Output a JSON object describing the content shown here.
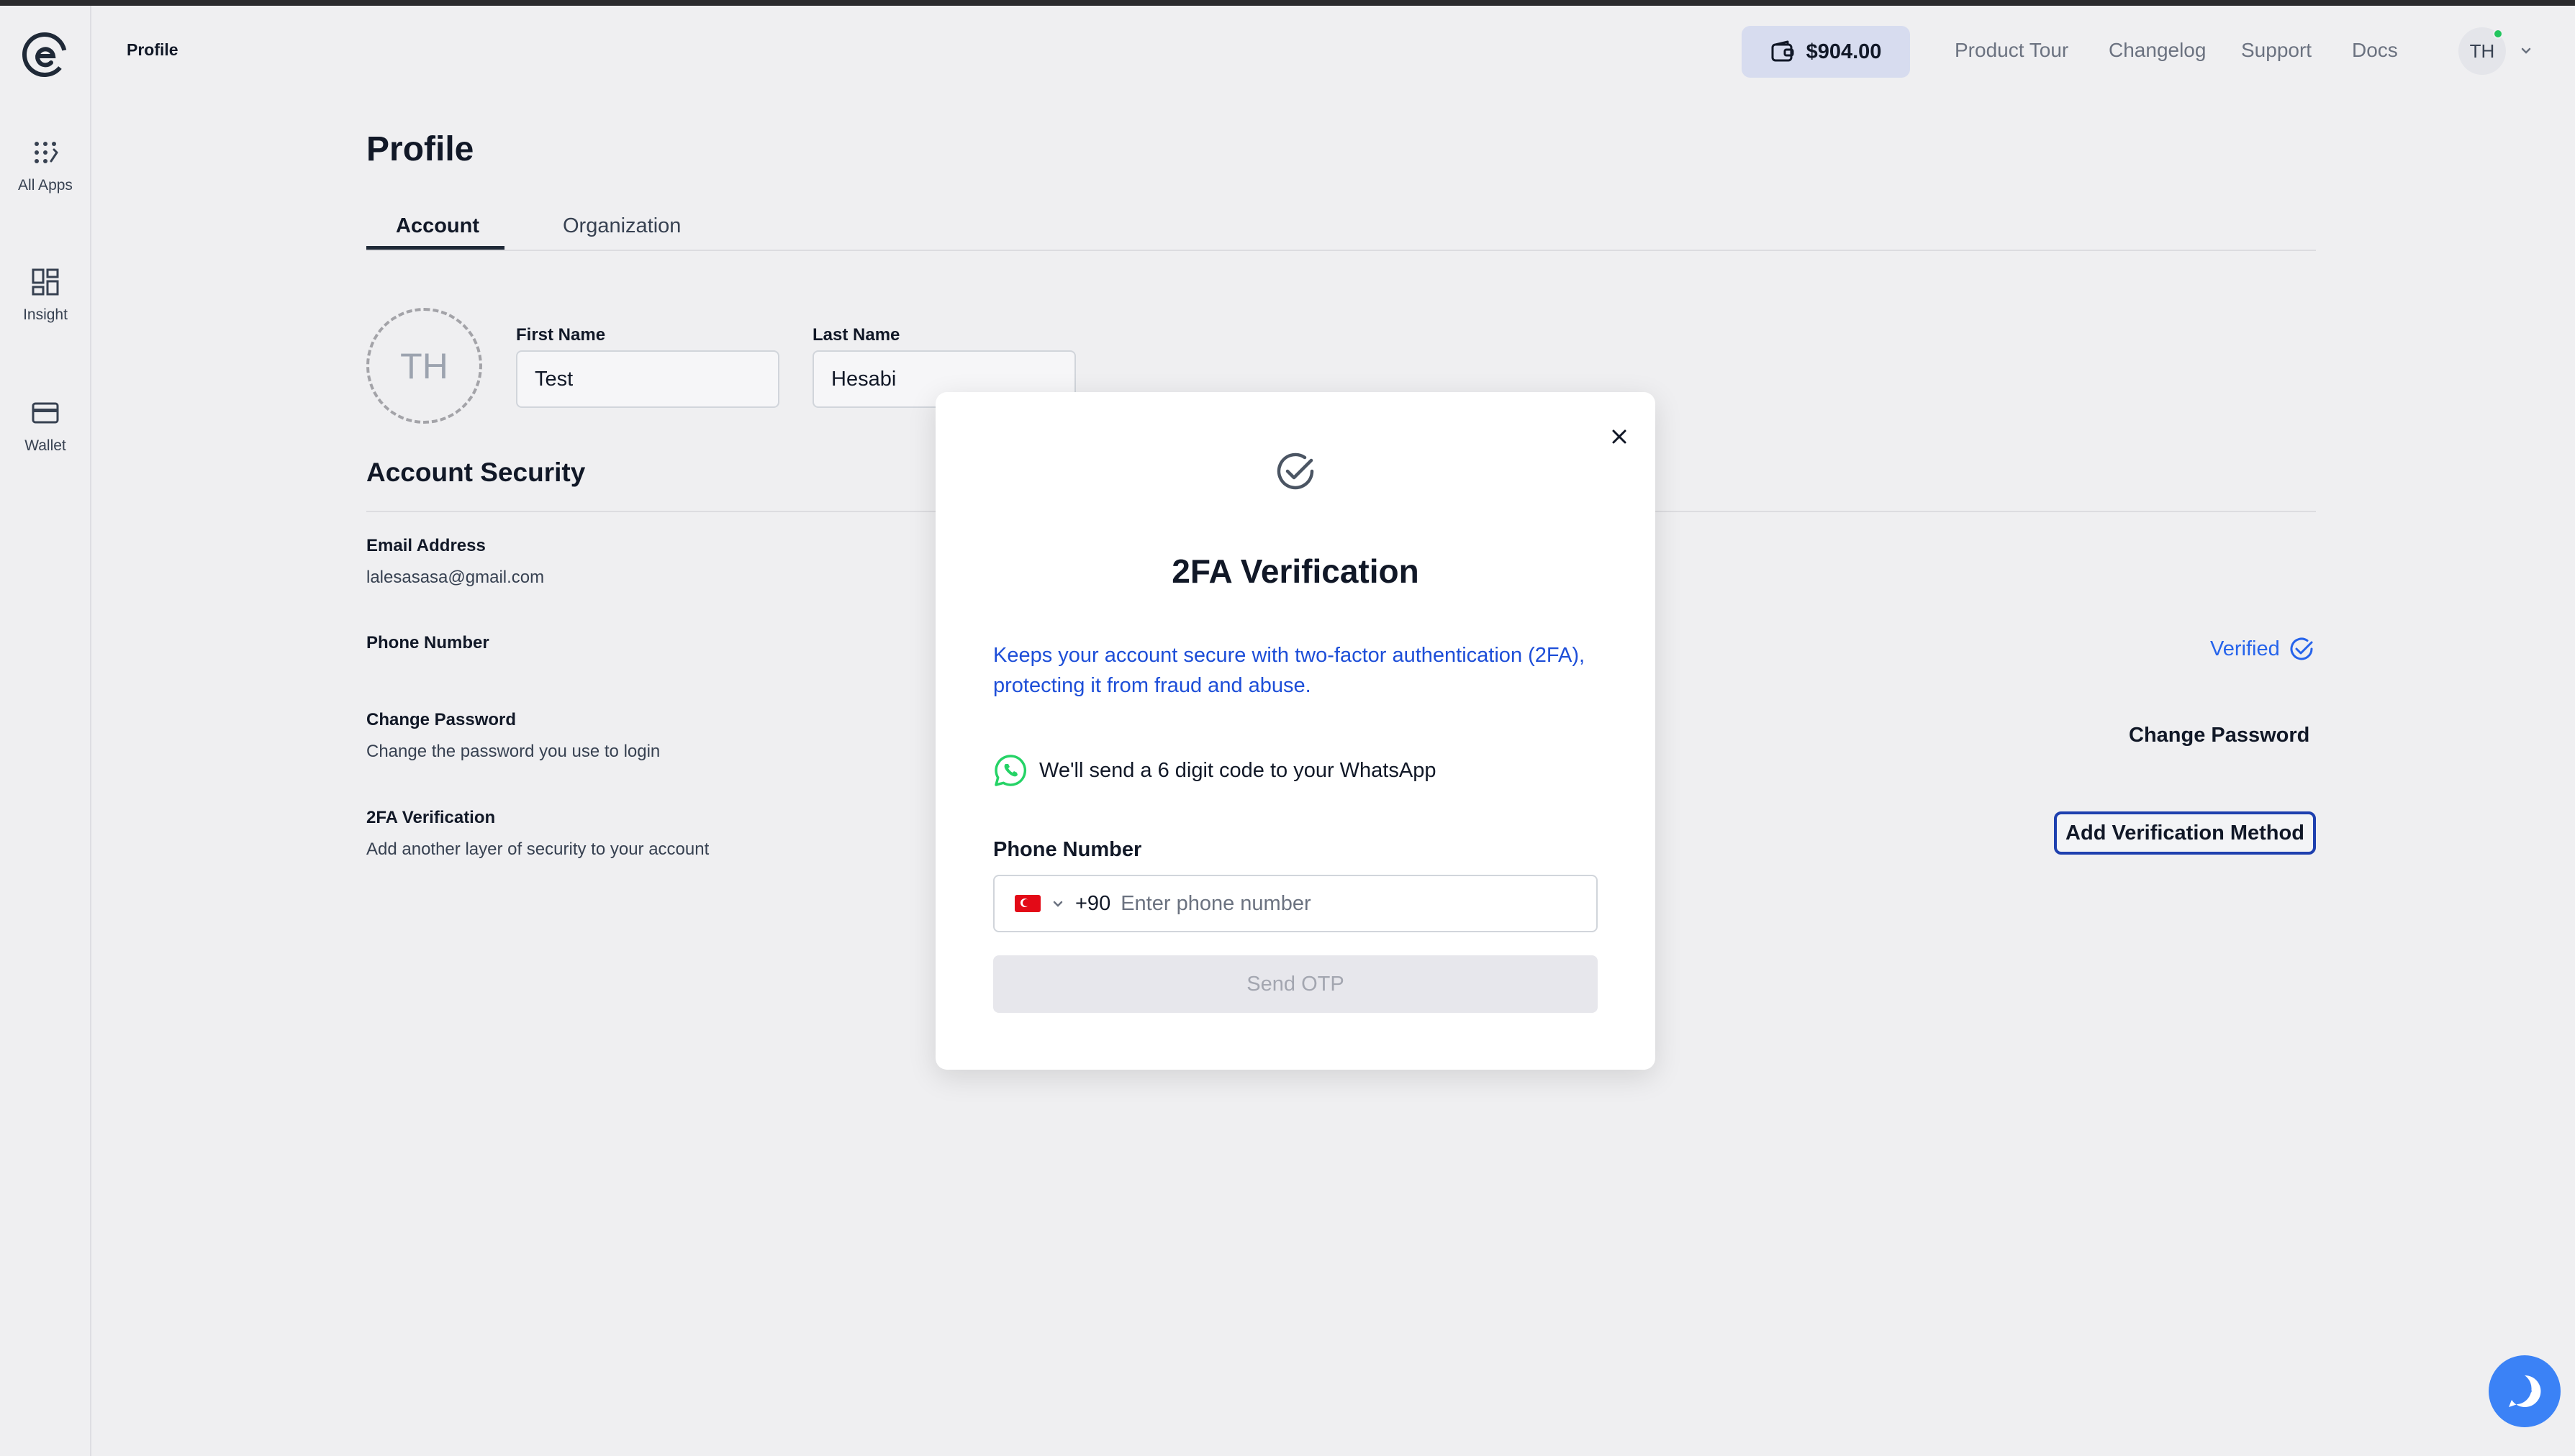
{
  "header": {
    "breadcrumb": "Profile",
    "wallet_balance": "$904.00",
    "nav": [
      "Product Tour",
      "Changelog",
      "Support",
      "Docs"
    ],
    "user_initials": "TH"
  },
  "sidebar": {
    "items": [
      {
        "label": "All Apps",
        "icon": "apps-grid-icon"
      },
      {
        "label": "Insight",
        "icon": "dashboard-icon"
      },
      {
        "label": "Wallet",
        "icon": "card-icon"
      }
    ]
  },
  "page": {
    "title": "Profile",
    "tabs": [
      "Account",
      "Organization"
    ],
    "active_tab": "Account",
    "avatar_initials": "TH",
    "first_name_label": "First Name",
    "first_name_value": "Test",
    "last_name_label": "Last Name",
    "last_name_value": "Hesabi"
  },
  "security": {
    "title": "Account Security",
    "email_label": "Email Address",
    "email_value": "lalesasasa@gmail.com",
    "phone_label": "Phone Number",
    "verified_text": "Verified",
    "change_password_label": "Change Password",
    "change_password_sub": "Change the password you use to login",
    "change_password_button": "Change Password",
    "twofa_label": "2FA Verification",
    "twofa_sub": "Add another layer of security to your account",
    "add_verification_button": "Add Verification Method"
  },
  "modal": {
    "title": "2FA Verification",
    "description": "Keeps your account secure with two-factor authentication (2FA), protecting it from fraud and abuse.",
    "whatsapp_note": "We'll send a 6 digit code to your WhatsApp",
    "phone_label": "Phone Number",
    "dial_code": "+90",
    "phone_placeholder": "Enter phone number",
    "phone_value": "",
    "send_button": "Send OTP"
  },
  "colors": {
    "accent_blue": "#2563eb",
    "wallet_pill": "#d7dcef",
    "whatsapp_green": "#25d366"
  }
}
